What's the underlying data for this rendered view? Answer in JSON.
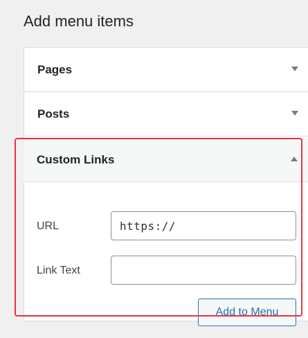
{
  "heading": "Add menu items",
  "sections": {
    "pages": {
      "title": "Pages",
      "expanded": false,
      "icon": "triangle-down-icon"
    },
    "posts": {
      "title": "Posts",
      "expanded": false,
      "icon": "triangle-down-icon"
    },
    "custom_links": {
      "title": "Custom Links",
      "expanded": true,
      "icon": "triangle-up-icon",
      "url_label": "URL",
      "url_value": "https://",
      "link_text_label": "Link Text",
      "link_text_value": "",
      "add_button_label": "Add to Menu"
    }
  },
  "colors": {
    "highlight_border": "#e8333f",
    "button_accent": "#2271b1"
  }
}
